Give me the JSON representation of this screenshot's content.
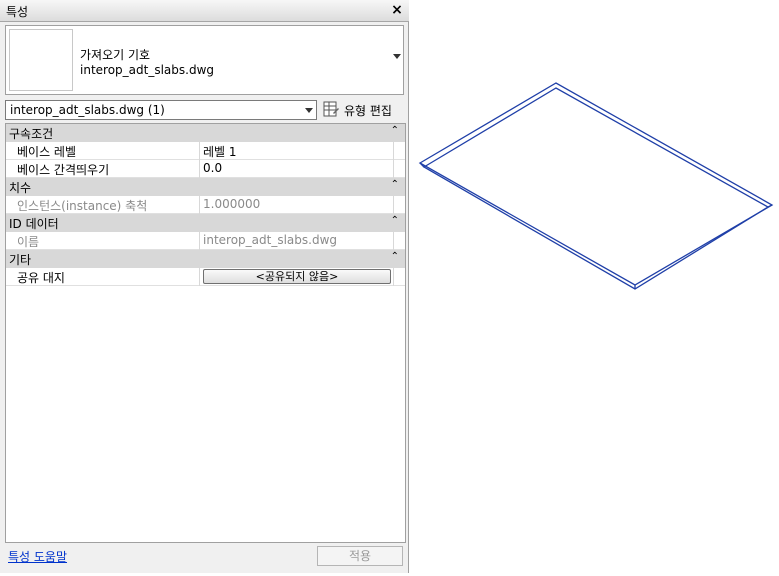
{
  "palette": {
    "title": "특성",
    "close_label": "×",
    "type_selector": {
      "family": "가져오기 기호",
      "type_name": "interop_adt_slabs.dwg"
    },
    "instance_filter": "interop_adt_slabs.dwg (1)",
    "edit_type_label": "유형 편집",
    "groups": [
      {
        "label": "구속조건",
        "rows": [
          {
            "name": "베이스 레벨",
            "value": "레벨 1"
          },
          {
            "name": "베이스 간격띄우기",
            "value": "0.0"
          }
        ]
      },
      {
        "label": "치수",
        "rows": [
          {
            "name": "인스턴스(instance) 축척",
            "value": "1.000000"
          }
        ]
      },
      {
        "label": "ID 데이터",
        "rows": [
          {
            "name": "이름",
            "value": "interop_adt_slabs.dwg"
          }
        ]
      },
      {
        "label": "기타",
        "rows": [
          {
            "name": "공유 대지",
            "value": "<공유되지 않음>"
          }
        ]
      }
    ],
    "collapse_glyph": "⌃",
    "help_link": "특성 도움말",
    "apply_label": "적용"
  },
  "colors": {
    "slab_outline": "#1f3fa8",
    "link": "#0033cc"
  }
}
